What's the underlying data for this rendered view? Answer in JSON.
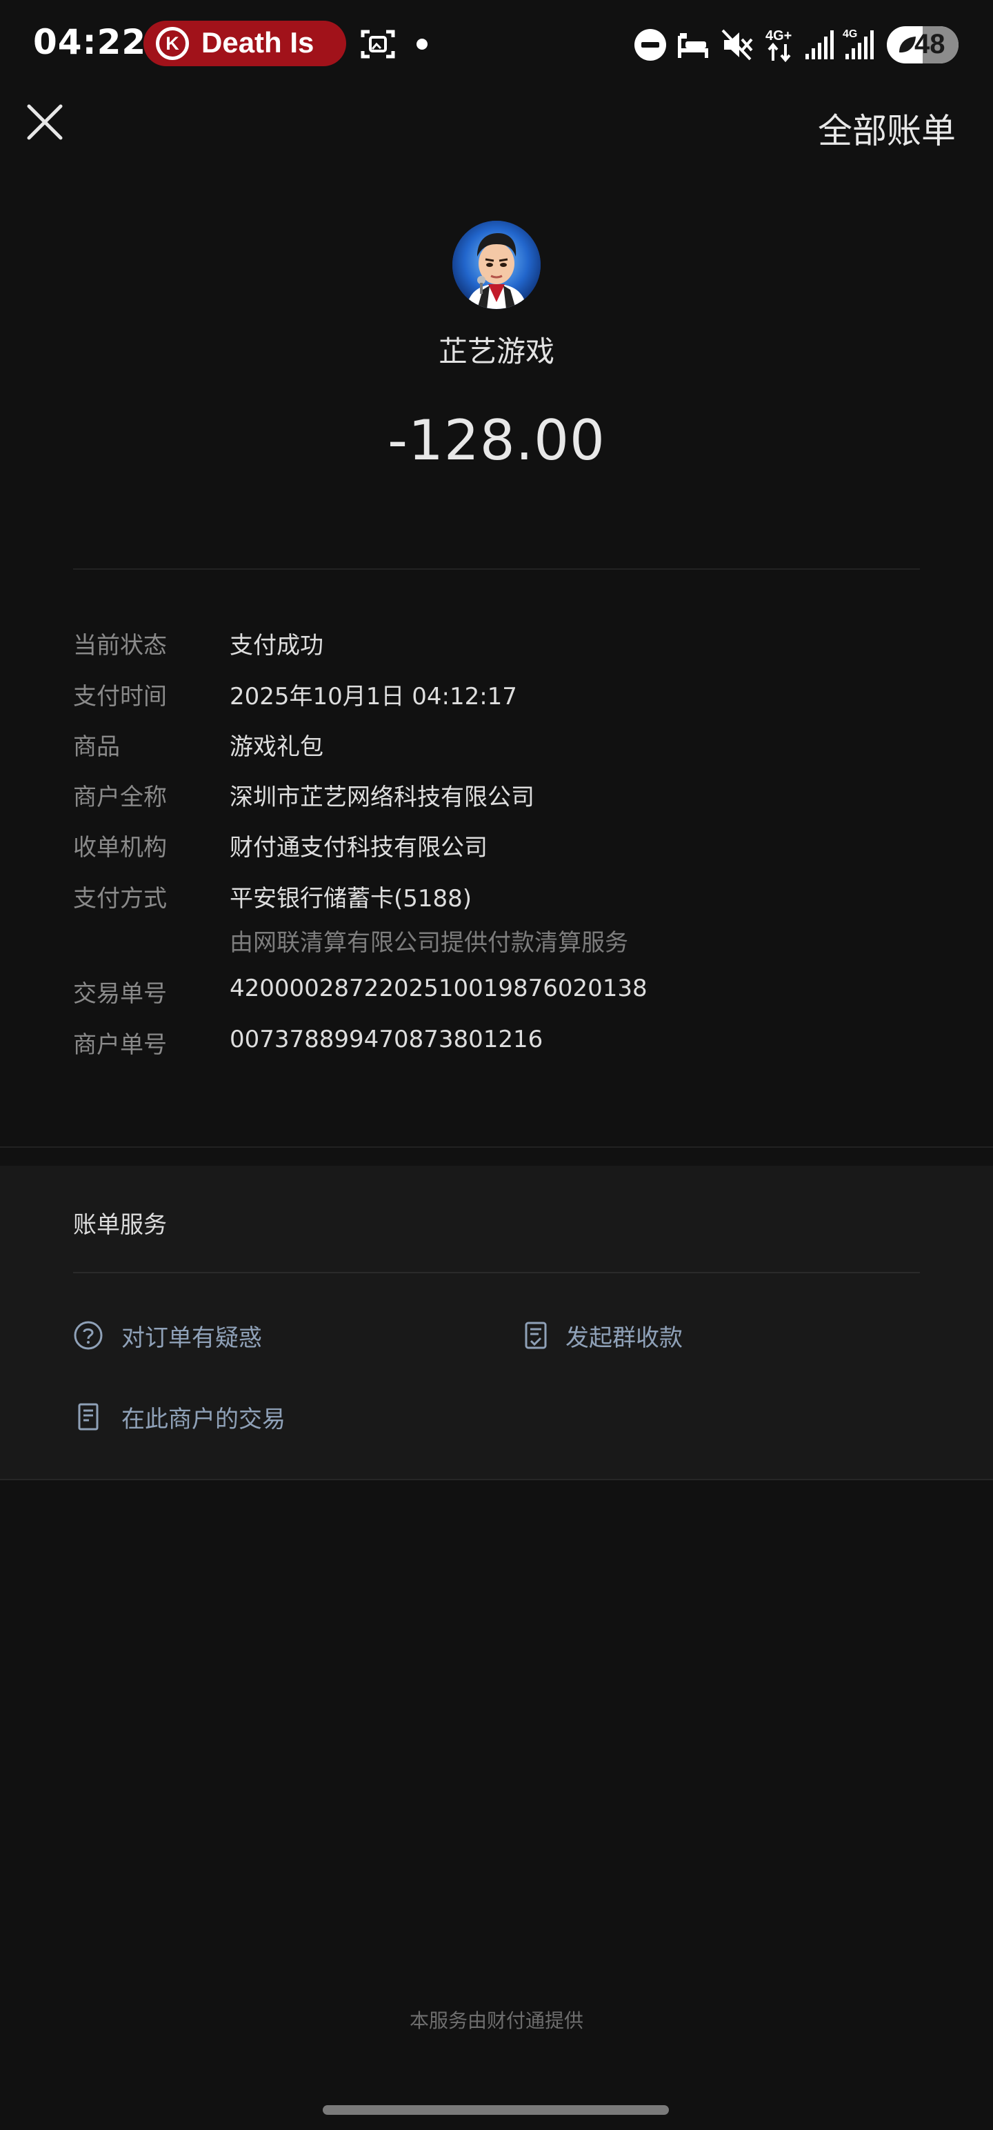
{
  "status_bar": {
    "time": "04:22",
    "media_badge_icon": "K",
    "media_title": "Death Is",
    "battery": "48",
    "network_1": "4G+",
    "network_2": "4G"
  },
  "nav": {
    "close_icon": "close-icon",
    "all_bills_label": "全部账单"
  },
  "header": {
    "merchant_name": "芷艺游戏",
    "amount": "-128.00"
  },
  "details": [
    {
      "label": "当前状态",
      "value": "支付成功"
    },
    {
      "label": "支付时间",
      "value": "2025年10月1日 04:12:17"
    },
    {
      "label": "商品",
      "value": "游戏礼包"
    },
    {
      "label": "商户全称",
      "value": "深圳市芷艺网络科技有限公司"
    },
    {
      "label": "收单机构",
      "value": "财付通支付科技有限公司"
    },
    {
      "label": "支付方式",
      "value": "平安银行储蓄卡(5188)",
      "sub": "由网联清算有限公司提供付款清算服务"
    },
    {
      "label": "交易单号",
      "value": "4200002872202510019876020138"
    },
    {
      "label": "商户单号",
      "value": "00737889947087380121​6"
    }
  ],
  "services": {
    "title": "账单服务",
    "items": [
      {
        "label": "对订单有疑惑",
        "icon": "question-icon"
      },
      {
        "label": "发起群收款",
        "icon": "checklist-icon"
      },
      {
        "label": "在此商户的交易",
        "icon": "receipt-icon"
      }
    ]
  },
  "footer": {
    "note": "本服务由财付通提供"
  },
  "colors": {
    "background": "#111111",
    "services_panel": "#191919",
    "link_text": "#8fa1b8",
    "media_badge": "#a1121a"
  }
}
